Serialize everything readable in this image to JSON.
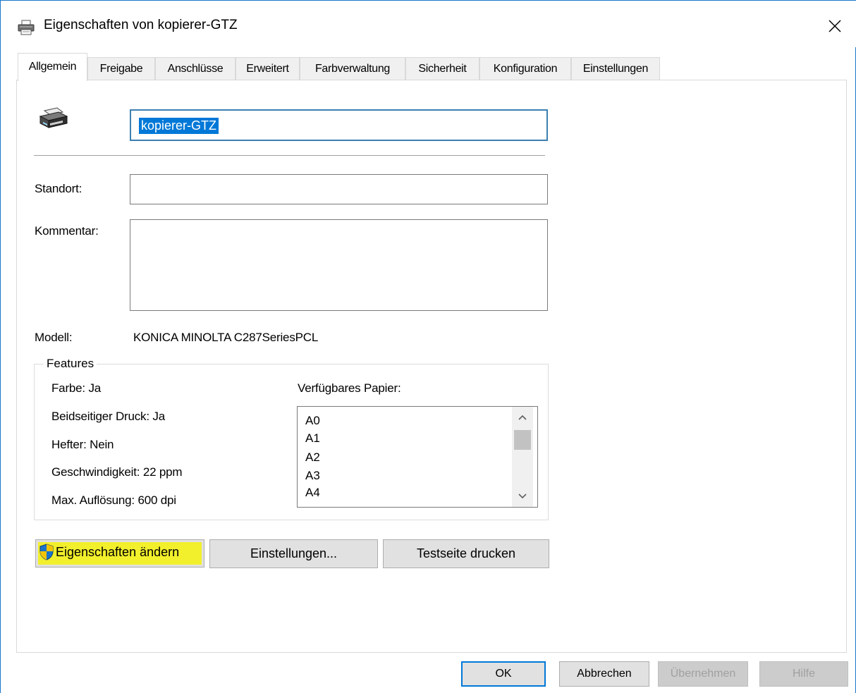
{
  "window": {
    "title": "Eigenschaften von kopierer-GTZ",
    "close_glyph": "✕"
  },
  "tabs": [
    {
      "label": "Allgemein",
      "active": true
    },
    {
      "label": "Freigabe"
    },
    {
      "label": "Anschlüsse"
    },
    {
      "label": "Erweitert"
    },
    {
      "label": "Farbverwaltung"
    },
    {
      "label": "Sicherheit"
    },
    {
      "label": "Konfiguration"
    },
    {
      "label": "Einstellungen"
    }
  ],
  "general": {
    "printer_name": "kopierer-GTZ",
    "location_label": "Standort:",
    "location_value": "",
    "comment_label": "Kommentar:",
    "comment_value": "",
    "model_label": "Modell:",
    "model_value": "KONICA MINOLTA C287SeriesPCL"
  },
  "features": {
    "title": "Features",
    "color": "Farbe: Ja",
    "duplex": "Beidseitiger Druck: Ja",
    "stapler": "Hefter: Nein",
    "speed": "Geschwindigkeit: 22 ppm",
    "resolution": "Max. Auflösung: 600 dpi",
    "paper_label": "Verfügbares Papier:",
    "paper_items": [
      "A0",
      "A1",
      "A2",
      "A3",
      "A4"
    ]
  },
  "buttons": {
    "change_properties": "Eigenschaften ändern",
    "settings": "Einstellungen...",
    "test_page": "Testseite drucken",
    "ok": "OK",
    "cancel": "Abbrechen",
    "apply": "Übernehmen",
    "help": "Hilfe"
  },
  "colors": {
    "highlight": "#f4f10c",
    "selection": "#0078d7",
    "focus_border": "#3c7fb1"
  }
}
